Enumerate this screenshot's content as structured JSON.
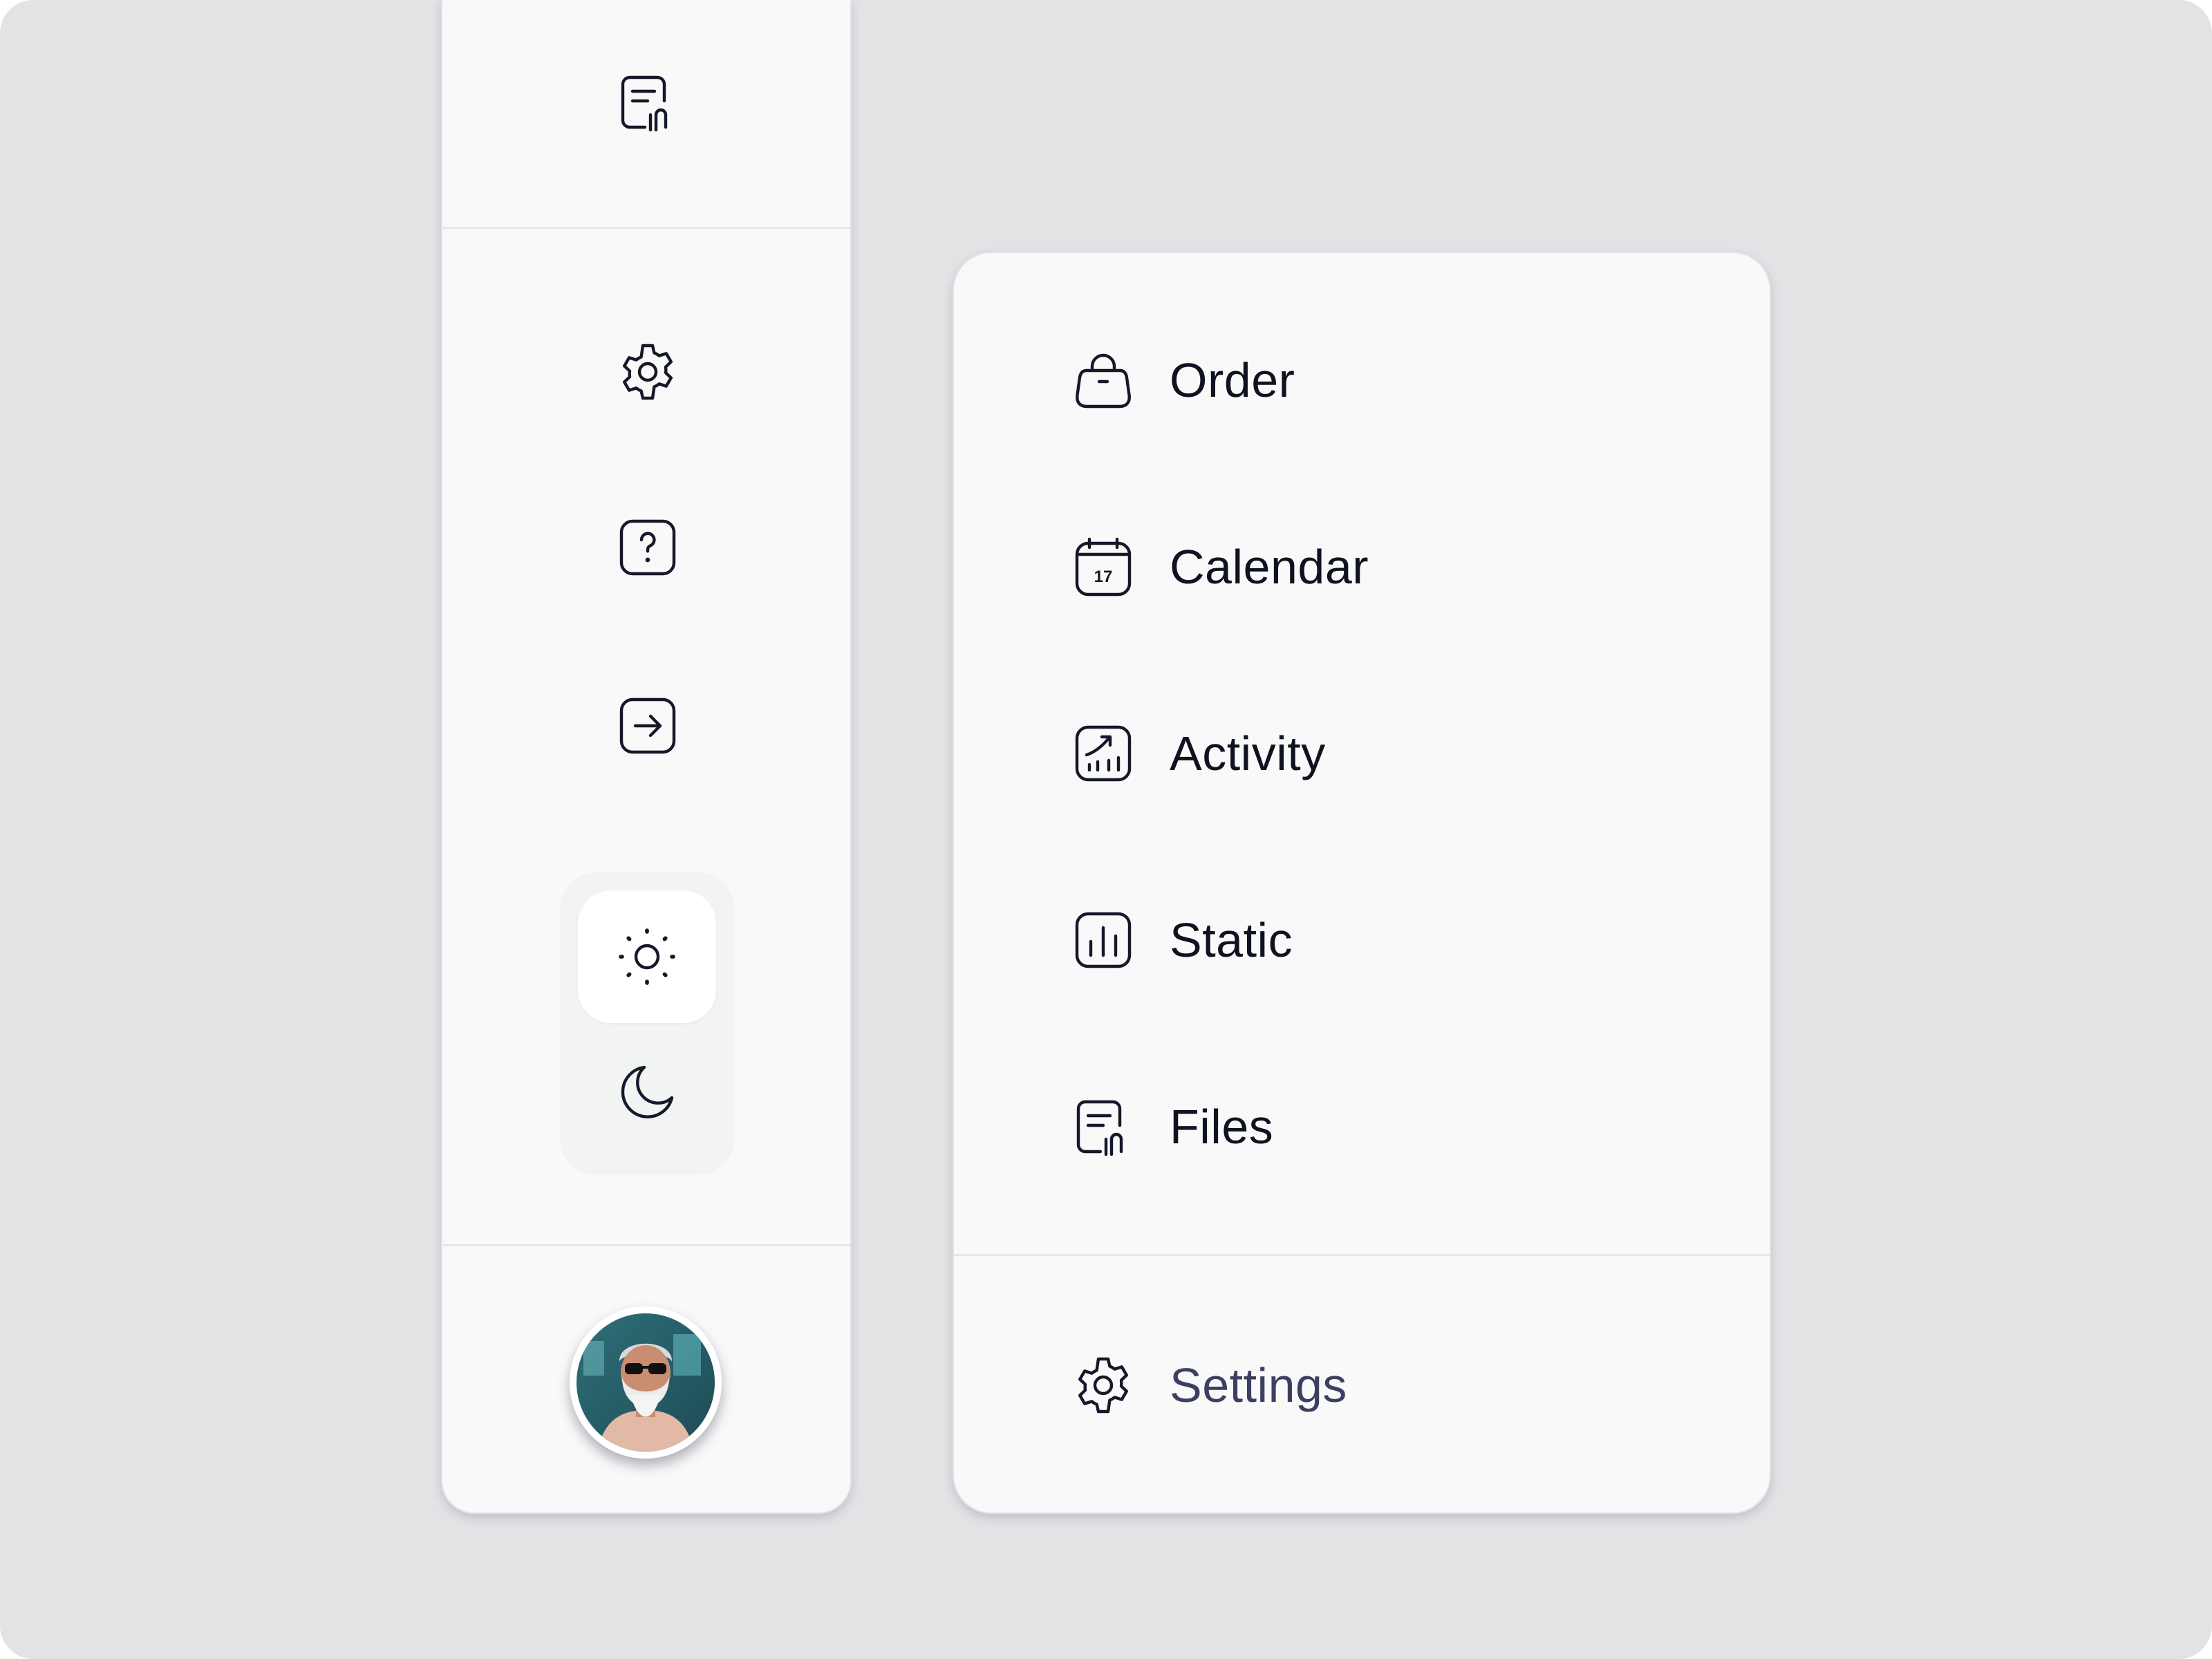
{
  "rail": {
    "top_icon": "file-attachment-icon",
    "icons": [
      "gear-icon",
      "help-icon",
      "logout-icon"
    ],
    "theme": {
      "options": [
        "sun-icon",
        "moon-icon"
      ],
      "selected": "light"
    },
    "avatar_icon": "avatar"
  },
  "menu": {
    "items": [
      {
        "label": "Order",
        "icon": "shopping-bag-icon"
      },
      {
        "label": "Calendar",
        "icon": "calendar-icon"
      },
      {
        "label": "Activity",
        "icon": "activity-chart-icon"
      },
      {
        "label": "Static",
        "icon": "bar-chart-icon"
      },
      {
        "label": "Files",
        "icon": "file-attachment-icon"
      }
    ],
    "settings": {
      "label": "Settings",
      "icon": "gear-icon"
    }
  },
  "icons": {
    "calendar_day": "17"
  },
  "colors": {
    "background": "#e3e3e6",
    "panel": "#f9f9f9",
    "icon_stroke": "#141829",
    "text": "#0f1220",
    "muted_text": "#3c4060"
  }
}
